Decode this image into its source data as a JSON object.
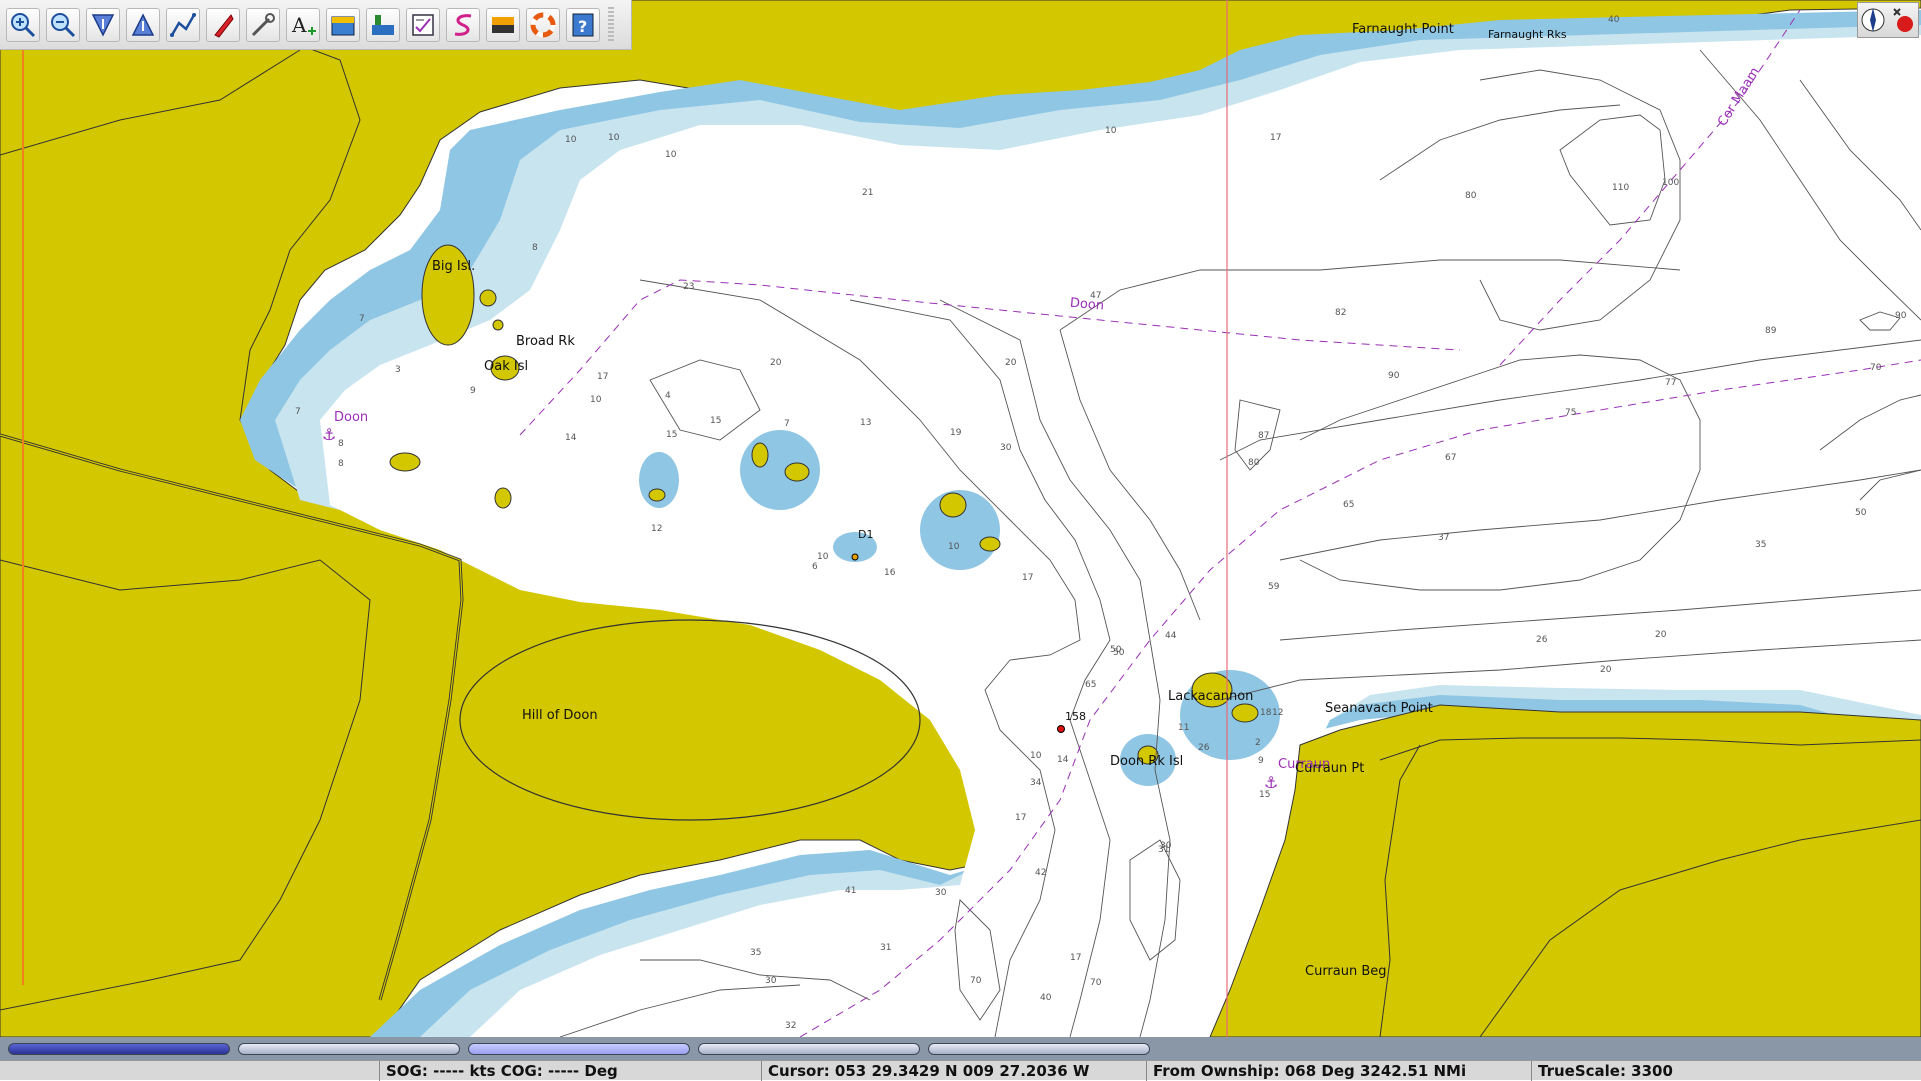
{
  "toolbar": {
    "items": [
      {
        "name": "zoom-in-icon",
        "label": "Zoom In"
      },
      {
        "name": "zoom-out-icon",
        "label": "Zoom Out"
      },
      {
        "name": "scale-in-icon",
        "label": "Chart Scale In"
      },
      {
        "name": "scale-out-icon",
        "label": "Chart Scale Out"
      },
      {
        "name": "route-icon",
        "label": "Route"
      },
      {
        "name": "follow-ship-icon",
        "label": "Follow Ship"
      },
      {
        "name": "settings-icon",
        "label": "Settings"
      },
      {
        "name": "text-icon",
        "label": "Text"
      },
      {
        "name": "chart-quilt-icon",
        "label": "Quilt"
      },
      {
        "name": "tides-icon",
        "label": "Tides"
      },
      {
        "name": "route-manager-icon",
        "label": "Route Manager"
      },
      {
        "name": "track-icon",
        "label": "Track"
      },
      {
        "name": "color-scheme-icon",
        "label": "Color Scheme"
      },
      {
        "name": "lifering-icon",
        "label": "MOB"
      },
      {
        "name": "help-icon",
        "label": "Help"
      }
    ]
  },
  "chart": {
    "colors": {
      "land": "#d3c700",
      "shallow": "#8fc6e4",
      "medium": "#c7e4ef",
      "deep": "#ffffff",
      "contour": "#333333"
    },
    "place_names": [
      "Farnaught Point",
      "Farnaught Rks",
      "Big Isl.",
      "Broad Rk",
      "Oak Isl",
      "Doon",
      "Hill of Doon",
      "Lackacannon",
      "Seanavach Point",
      "Doon Rk Isl",
      "Curraun",
      "Curraun Pt",
      "Curraun Beg",
      "158",
      "D1",
      "Cor Maam",
      "Doon"
    ],
    "depth_labels": [
      {
        "t": "10"
      },
      {
        "t": "10"
      },
      {
        "t": "21"
      },
      {
        "t": "23"
      },
      {
        "t": "20"
      },
      {
        "t": "19"
      },
      {
        "t": "30"
      },
      {
        "t": "50"
      },
      {
        "t": "47"
      },
      {
        "t": "20"
      },
      {
        "t": "82"
      },
      {
        "t": "90"
      },
      {
        "t": "77"
      },
      {
        "t": "89"
      },
      {
        "t": "90"
      },
      {
        "t": "70"
      },
      {
        "t": "75"
      },
      {
        "t": "67"
      },
      {
        "t": "65"
      },
      {
        "t": "87"
      },
      {
        "t": "80"
      },
      {
        "t": "37"
      },
      {
        "t": "35"
      },
      {
        "t": "50"
      },
      {
        "t": "59"
      },
      {
        "t": "26"
      },
      {
        "t": "20"
      },
      {
        "t": "20"
      },
      {
        "t": "17"
      },
      {
        "t": "80"
      },
      {
        "t": "100"
      },
      {
        "t": "110"
      },
      {
        "t": "40"
      },
      {
        "t": "8"
      },
      {
        "t": "7"
      },
      {
        "t": "3"
      },
      {
        "t": "9"
      },
      {
        "t": "7"
      },
      {
        "t": "8"
      },
      {
        "t": "8"
      },
      {
        "t": "17"
      },
      {
        "t": "14"
      },
      {
        "t": "10"
      },
      {
        "t": "15"
      },
      {
        "t": "15"
      },
      {
        "t": "7"
      },
      {
        "t": "13"
      },
      {
        "t": "12"
      },
      {
        "t": "10"
      },
      {
        "t": "16"
      },
      {
        "t": "10"
      },
      {
        "t": "17"
      },
      {
        "t": "6"
      },
      {
        "t": "50"
      },
      {
        "t": "65"
      },
      {
        "t": "44"
      },
      {
        "t": "11"
      },
      {
        "t": "26"
      },
      {
        "t": "10"
      },
      {
        "t": "34"
      },
      {
        "t": "17"
      },
      {
        "t": "42"
      },
      {
        "t": "31"
      },
      {
        "t": "30"
      },
      {
        "t": "41"
      },
      {
        "t": "30"
      },
      {
        "t": "35"
      },
      {
        "t": "31"
      },
      {
        "t": "30"
      },
      {
        "t": "32"
      },
      {
        "t": "70"
      },
      {
        "t": "70"
      },
      {
        "t": "17"
      },
      {
        "t": "40"
      },
      {
        "t": "9"
      },
      {
        "t": "15"
      },
      {
        "t": "18"
      },
      {
        "t": "12"
      },
      {
        "t": "2"
      },
      {
        "t": "14"
      },
      {
        "t": "10"
      },
      {
        "t": "10"
      },
      {
        "t": "4"
      }
    ]
  },
  "compass": {
    "name": "compass-icon"
  },
  "piano": {
    "keys": [
      {
        "state": "active"
      },
      {
        "state": "normal"
      },
      {
        "state": "mid"
      },
      {
        "state": "normal"
      },
      {
        "state": "normal"
      }
    ]
  },
  "status": {
    "sog": "SOG: ----- kts  COG: ----- Deg",
    "cursor": "Cursor: 053 29.3429 N 009 27.2036 W",
    "from_ownship": "From Ownship: 068 Deg  3242.51 NMi",
    "truescale": "TrueScale:     3300"
  }
}
